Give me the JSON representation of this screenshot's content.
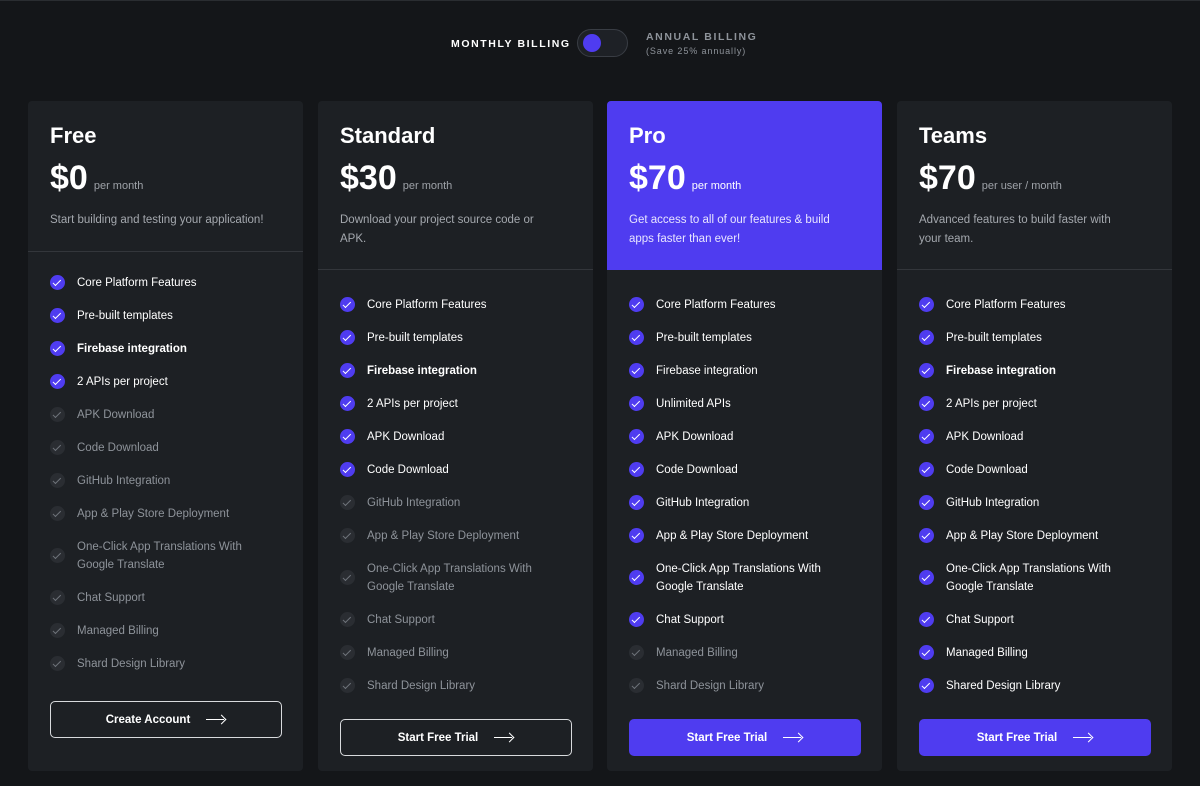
{
  "billing": {
    "monthly_label": "MONTHLY BILLING",
    "annual_label": "ANNUAL BILLING",
    "annual_note": "(Save 25% annually)"
  },
  "colors": {
    "accent": "#4f3cf0",
    "background": "#141619",
    "card": "#1d2024"
  },
  "plans": [
    {
      "name": "Free",
      "price": "$0",
      "period": "per month",
      "description": "Start building and testing your application!",
      "cta": "Create Account",
      "features": [
        {
          "label": "Core Platform Features",
          "included": true
        },
        {
          "label": "Pre-built templates",
          "included": true
        },
        {
          "label": "Firebase integration",
          "included": true
        },
        {
          "label": "2 APIs per project",
          "included": true
        },
        {
          "label": "APK Download",
          "included": false
        },
        {
          "label": "Code Download",
          "included": false
        },
        {
          "label": "GitHub Integration",
          "included": false
        },
        {
          "label": "App & Play Store Deployment",
          "included": false
        },
        {
          "label": "One-Click App Translations With Google Translate",
          "included": false
        },
        {
          "label": "Chat Support",
          "included": false
        },
        {
          "label": "Managed Billing",
          "included": false
        },
        {
          "label": "Shard Design Library",
          "included": false
        }
      ]
    },
    {
      "name": "Standard",
      "price": "$30",
      "period": "per month",
      "description": "Download your project source code or APK.",
      "cta": "Start Free Trial",
      "features": [
        {
          "label": "Core Platform Features",
          "included": true
        },
        {
          "label": "Pre-built templates",
          "included": true
        },
        {
          "label": "Firebase integration",
          "included": true
        },
        {
          "label": "2 APIs per project",
          "included": true
        },
        {
          "label": "APK Download",
          "included": true
        },
        {
          "label": "Code Download",
          "included": true
        },
        {
          "label": "GitHub Integration",
          "included": false
        },
        {
          "label": "App & Play Store Deployment",
          "included": false
        },
        {
          "label": "One-Click App Translations With Google Translate",
          "included": false
        },
        {
          "label": "Chat Support",
          "included": false
        },
        {
          "label": "Managed Billing",
          "included": false
        },
        {
          "label": "Shard Design Library",
          "included": false
        }
      ]
    },
    {
      "name": "Pro",
      "price": "$70",
      "period": "per month",
      "description": "Get access to all of our features & build apps faster than ever!",
      "cta": "Start Free Trial",
      "features": [
        {
          "label": "Core Platform Features",
          "included": true
        },
        {
          "label": "Pre-built templates",
          "included": true
        },
        {
          "label": "Firebase integration",
          "included": true
        },
        {
          "label": "Unlimited APIs",
          "included": true
        },
        {
          "label": "APK Download",
          "included": true
        },
        {
          "label": "Code Download",
          "included": true
        },
        {
          "label": "GitHub Integration",
          "included": true
        },
        {
          "label": "App & Play Store Deployment",
          "included": true
        },
        {
          "label": "One-Click  App Translations With Google Translate",
          "included": true
        },
        {
          "label": "Chat Support",
          "included": true
        },
        {
          "label": "Managed Billing",
          "included": false
        },
        {
          "label": "Shard Design Library",
          "included": false
        }
      ]
    },
    {
      "name": "Teams",
      "price": "$70",
      "period": "per user / month",
      "description": "Advanced features to build faster with your team.",
      "cta": "Start Free Trial",
      "features": [
        {
          "label": "Core Platform Features",
          "included": true
        },
        {
          "label": "Pre-built templates",
          "included": true
        },
        {
          "label": "Firebase integration",
          "included": true
        },
        {
          "label": "2 APIs per project",
          "included": true
        },
        {
          "label": "APK Download",
          "included": true
        },
        {
          "label": "Code Download",
          "included": true
        },
        {
          "label": "GitHub Integration",
          "included": true
        },
        {
          "label": "App & Play Store Deployment",
          "included": true
        },
        {
          "label": "One-Click  App Translations With Google Translate",
          "included": true
        },
        {
          "label": "Chat Support",
          "included": true
        },
        {
          "label": "Managed Billing",
          "included": true
        },
        {
          "label": "Shared Design Library",
          "included": true
        }
      ]
    }
  ]
}
